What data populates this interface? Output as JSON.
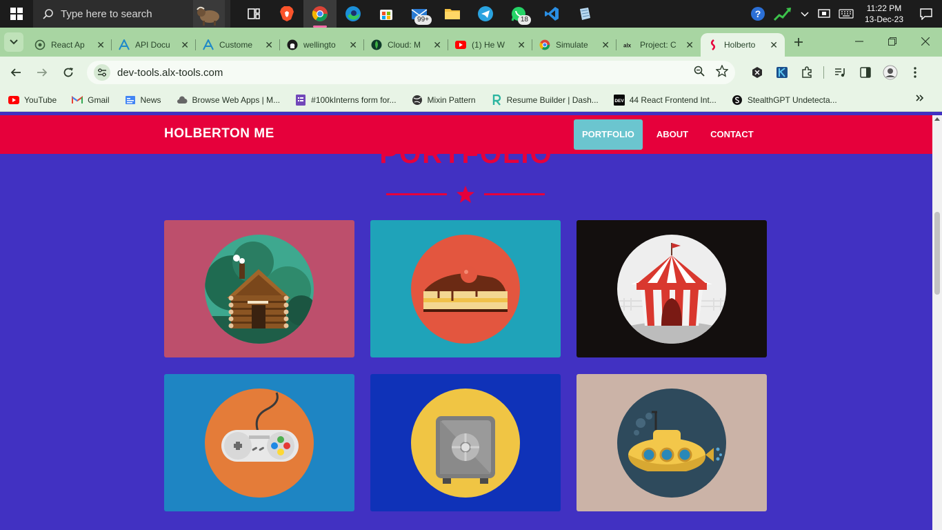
{
  "taskbar": {
    "search_placeholder": "Type here to search",
    "mail_badge": "99+",
    "whatsapp_badge": "18",
    "time": "11:22 PM",
    "date": "13-Dec-23"
  },
  "tabs": [
    {
      "title": "React Ap",
      "icon": "openai-icon"
    },
    {
      "title": "API Docu",
      "icon": "a-logo-icon"
    },
    {
      "title": "Custome",
      "icon": "a-logo-icon"
    },
    {
      "title": "wellingto",
      "icon": "github-icon"
    },
    {
      "title": "Cloud: M",
      "icon": "mongodb-icon"
    },
    {
      "title": "(1) He W",
      "icon": "youtube-icon"
    },
    {
      "title": "Simulate",
      "icon": "chrome-icon"
    },
    {
      "title": "Project: C",
      "icon": "alx-icon"
    },
    {
      "title": "Holberto",
      "icon": "holberton-icon"
    }
  ],
  "toolbar": {
    "url": "dev-tools.alx-tools.com"
  },
  "bookmarks": [
    {
      "label": "YouTube"
    },
    {
      "label": "Gmail"
    },
    {
      "label": "News"
    },
    {
      "label": "Browse Web Apps | M..."
    },
    {
      "label": "#100kInterns form for..."
    },
    {
      "label": "Mixin Pattern"
    },
    {
      "label": "Resume Builder | Dash..."
    },
    {
      "label": "44 React Frontend Int..."
    },
    {
      "label": "StealthGPT Undetecta..."
    }
  ],
  "site": {
    "brand": "HOLBERTON ME",
    "nav": [
      {
        "label": "PORTFOLIO",
        "active": true
      },
      {
        "label": "ABOUT",
        "active": false
      },
      {
        "label": "CONTACT",
        "active": false
      }
    ],
    "section_title": "PORTFOLIO",
    "portfolio": [
      {
        "name": "cabin",
        "bg": "#bd4f6c"
      },
      {
        "name": "cake",
        "bg": "#1fa3b9"
      },
      {
        "name": "circus",
        "bg": "#130f0e"
      },
      {
        "name": "game",
        "bg": "#1e85c3"
      },
      {
        "name": "safe",
        "bg": "#0f32b8"
      },
      {
        "name": "submarine",
        "bg": "#cbb3a7"
      }
    ]
  },
  "colors": {
    "page_bg": "#4131c2",
    "nav_bg": "#e6003b",
    "nav_active": "#6bc5cf",
    "accent": "#e6003b"
  }
}
